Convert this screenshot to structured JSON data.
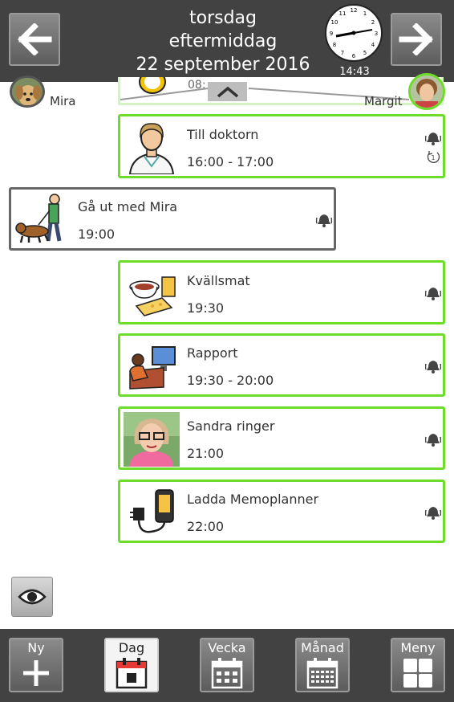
{
  "header": {
    "weekday": "torsdag",
    "part_of_day": "eftermiddag",
    "date": "22 september 2016",
    "clock_time": "14:43",
    "prev_icon": "arrow-left-icon",
    "next_icon": "arrow-right-icon"
  },
  "people": {
    "left_name": "Mira",
    "right_name": "Margit"
  },
  "partial_activity": {
    "time_fragment": "08:",
    "icon": "alarm-clock-icon"
  },
  "activities": [
    {
      "title": "Till doktorn",
      "time": "16:00 - 17:00",
      "icon": "doctor-icon",
      "alarm": true,
      "repeat": true,
      "border_color": "#6ddc2b"
    },
    {
      "title": "Gå ut med Mira",
      "time": "19:00",
      "icon": "dog-walk-icon",
      "alarm": true,
      "repeat": false,
      "border_color": "#666666"
    },
    {
      "title": "Kvällsmat",
      "time": "19:30",
      "icon": "dinner-icon",
      "alarm": true,
      "repeat": false,
      "border_color": "#6ddc2b"
    },
    {
      "title": "Rapport",
      "time": "19:30 - 20:00",
      "icon": "computer-desk-icon",
      "alarm": true,
      "repeat": false,
      "border_color": "#6ddc2b"
    },
    {
      "title": "Sandra ringer",
      "time": "21:00",
      "icon": "person-photo-icon",
      "alarm": true,
      "repeat": false,
      "border_color": "#6ddc2b"
    },
    {
      "title": "Ladda Memoplanner",
      "time": "22:00",
      "icon": "charger-icon",
      "alarm": true,
      "repeat": false,
      "border_color": "#6ddc2b"
    }
  ],
  "footer": {
    "new": "Ny",
    "day": "Dag",
    "week": "Vecka",
    "month": "Månad",
    "menu": "Meny"
  },
  "colors": {
    "accent_green": "#6ddc2b",
    "header_bg": "#424242"
  }
}
